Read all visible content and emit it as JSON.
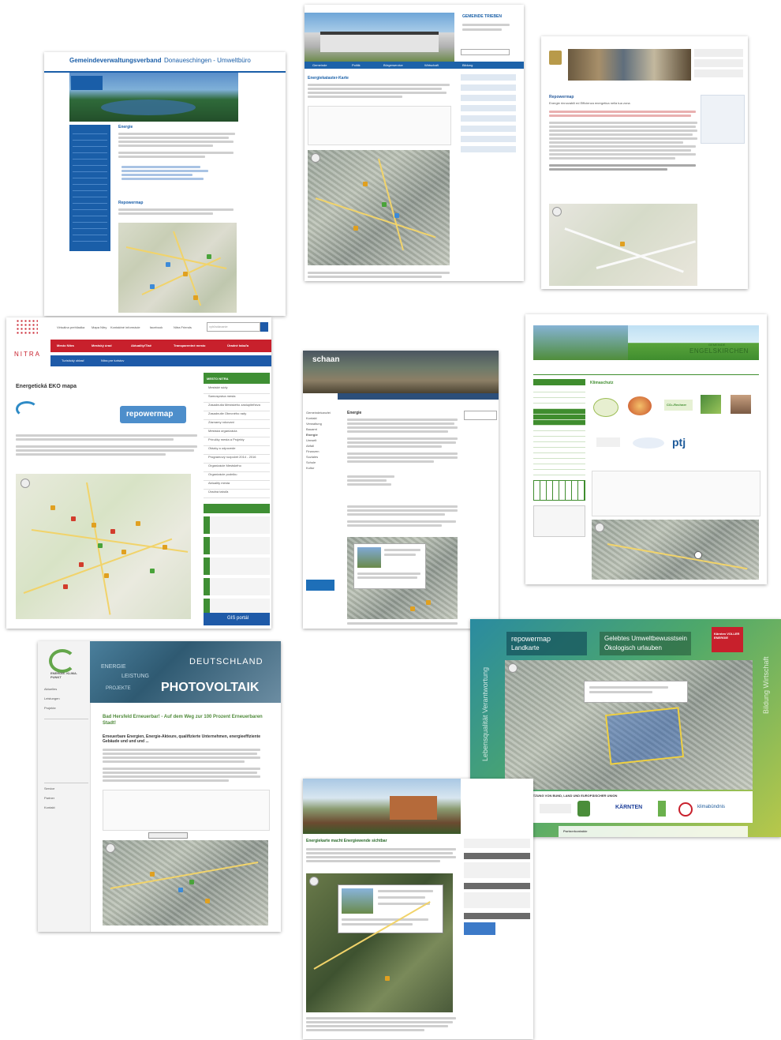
{
  "colors": {
    "donau_blue": "#1a5ea8",
    "nitra_red": "#c8202c",
    "nitra_blue": "#1e5aa8",
    "nitra_green": "#3f8f34",
    "engels_green": "#3f8d2e",
    "schaan_dark": "#2a2a2a",
    "repowermap_teal": "#1e7c7a",
    "ekp_green": "#63a64a"
  },
  "donau": {
    "title": "Gemeindeverwaltungsverband",
    "title_suffix": "Donaueschingen - Umweltbüro",
    "heading": "Energie",
    "subheading": "Repowermap"
  },
  "trieben": {
    "brand": "GEMEINDE TRIEBEN",
    "nav": [
      "Gemeinde",
      "Politik",
      "Bürgerservice",
      "Wirtschaft",
      "Bildung"
    ],
    "heading": "Energiekataster-Karte"
  },
  "fobello": {
    "heading": "Repowermap",
    "subheading": "Energie rinnovabili ed Efficienza energetica nella tua zona"
  },
  "nitra": {
    "brand": "NITRA",
    "top_links": [
      "Virtuálna prehliadka",
      "Mapa Nitry",
      "Kontaktné informácie",
      "facebook",
      "Nitra Friends"
    ],
    "search_placeholder": "vyhľadávanie",
    "red_nav": [
      "Mesto Nitra",
      "Mestský úrad",
      "Aktuality/Tlač",
      "Transparentné mesto",
      "Úradné tabuľa"
    ],
    "blue_nav": [
      "Turistický oblasť",
      "Nitra pre turistov"
    ],
    "heading": "Energetická EKO mapa",
    "logo_text": "repowermap",
    "sidebar_title": "MESTO NITRA",
    "sidebar_items": [
      "Mestské súdy",
      "Samospráva mesta",
      "Zasadnutia Mestského zastupiteľstva",
      "Zasadnutie Obecného rady",
      "Záznamy rokovaní",
      "Mestská organizácia",
      "Príručky mesta a Projekty",
      "Otázky a odpovede",
      "Programový rozpočet 2014 - 2016",
      "Organizácie Mestského",
      "Organizácie podniku",
      "Aktuality mesta",
      "Úradná tabuľa"
    ],
    "gis_label": "GIS portál"
  },
  "schaan": {
    "brand": "schaan",
    "heading": "Energie",
    "left_nav": [
      "Gemeindekanzlei",
      "Kontakt",
      "Verwaltung",
      "Bauamt",
      "Energie",
      "Umwelt",
      "Abfall",
      "Finanzen",
      "Soziales",
      "Schule",
      "Kultur"
    ]
  },
  "engelskirchen": {
    "brand_small": "GEMEINDE",
    "brand": "ENGELSKIRCHEN",
    "heading": "Klimaschutz",
    "co2_badge": "CO₂-Rechner",
    "ptj_badge": "ptj"
  },
  "ekp": {
    "brand": "ENERGIE. KLIMA. PUNKT",
    "banner_words": [
      "DEUTSCHLAND",
      "PHOTOVOLTAIK",
      "ENERGIE",
      "LEISTUNG",
      "PROJEKTE"
    ],
    "side_nav": [
      "Aktuelles",
      "Leistungen",
      "Projekte",
      "Service",
      "Partner",
      "Kontakt"
    ],
    "heading": "Bad Hersfeld Erneuerbar! - Auf dem Weg zur 100 Prozent Erneuerbaren Stadt!",
    "subheading": "Erneuerbare Energien, Energie-Akteure, qualifizierte Unternehmen, energieeffiziente Gebäude und und und ..."
  },
  "kaernten": {
    "tab1": "repowermap",
    "tab1_sub": "Landkarte",
    "tab2": "Gelebtes Umweltbewusstsein",
    "tab2_sub": "Ökologisch urlauben",
    "side_left": "Lebensqualität Verantwortung",
    "side_right": "Bildung Wirtschaft",
    "logo": "Kärnten VOLLER ENERGIE",
    "support": "MIT UNTERSTÜTZUNG VON BUND, LAND UND EUROPÄISCHER UNION",
    "logos": [
      "KÄRNTEN",
      "klimabündnis"
    ],
    "bottom": "Partnerkontakte"
  },
  "mauren": {
    "heading": "Energiekarte macht Energiewende sichtbar"
  }
}
